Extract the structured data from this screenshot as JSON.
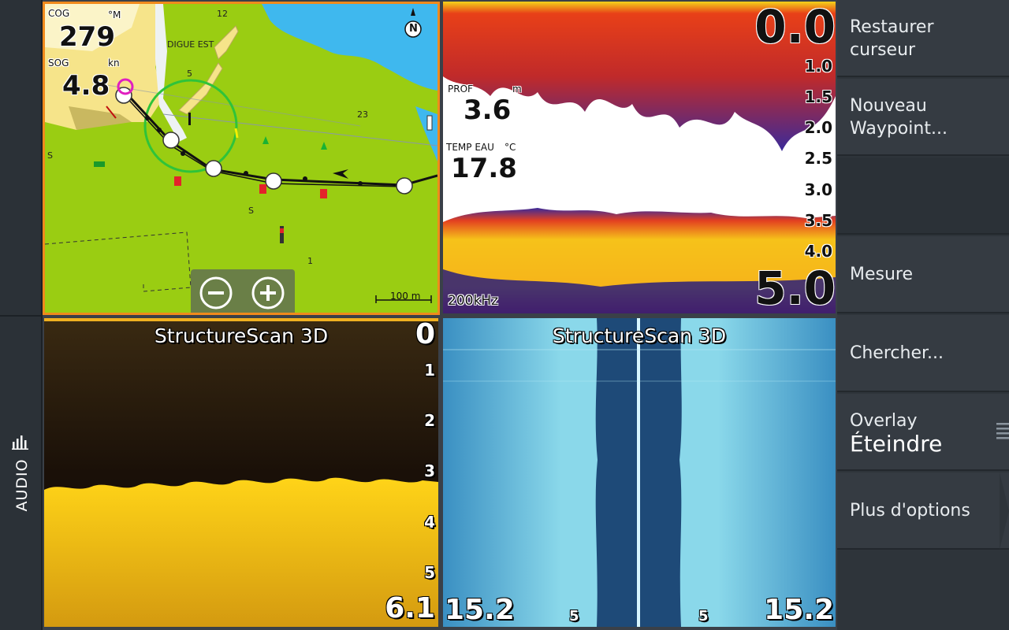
{
  "left_strip": {
    "audio_label": "AUDIO"
  },
  "chart": {
    "cog_label": "COG",
    "cog_value": "279",
    "cog_unit": "°M",
    "sog_label": "SOG",
    "sog_value": "4.8",
    "sog_unit": "kn",
    "place_label": "DIGUE EST",
    "scale_label": "100 m",
    "soundings": [
      "12",
      "23",
      "1",
      "5",
      "S",
      "S",
      "S"
    ],
    "north_label": "N"
  },
  "sonar": {
    "depth_top": "0.0",
    "depth_bottom": "5.0",
    "scale_ticks": [
      "1.0",
      "1.5",
      "2.0",
      "2.5",
      "3.0",
      "3.5",
      "4.0"
    ],
    "prof_label": "PROF",
    "prof_unit": "m",
    "prof_value": "3.6",
    "temp_label": "TEMP EAU",
    "temp_unit": "°C",
    "temp_value": "17.8",
    "freq_label": "200kHz"
  },
  "ss_left": {
    "title": "StructureScan 3D",
    "depth_top": "0",
    "ticks": [
      "1",
      "2",
      "3",
      "4",
      "5"
    ],
    "depth_bottom": "6.1"
  },
  "ss_right": {
    "title": "StructureScan 3D",
    "range_left": "15.2",
    "range_right": "15.2",
    "tick_left": "5",
    "tick_right": "5"
  },
  "menu": {
    "items": [
      {
        "line1": "Restaurer",
        "line2": "curseur"
      },
      {
        "line1": "Nouveau",
        "line2": "Waypoint..."
      },
      {
        "line1": ""
      },
      {
        "line1": "Mesure"
      },
      {
        "line1": "Chercher..."
      },
      {
        "line1": "Overlay",
        "line2": "Éteindre"
      },
      {
        "line1": "Plus d'options"
      }
    ]
  }
}
